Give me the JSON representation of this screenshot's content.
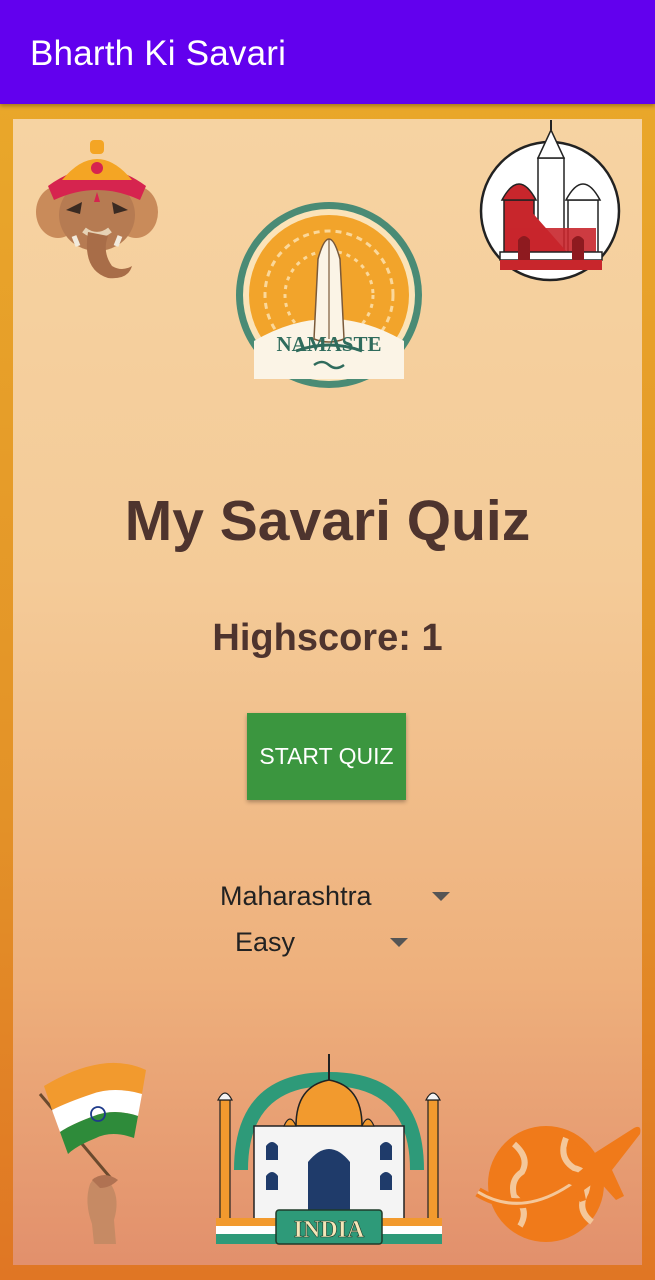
{
  "app": {
    "title": "Bharth Ki Savari"
  },
  "main": {
    "title": "My Savari Quiz",
    "highscore_label": "Highscore",
    "highscore_value": "1",
    "start_button": "START QUIZ",
    "state_spinner": "Maharashtra",
    "difficulty_spinner": "Easy"
  },
  "images": {
    "namaste_text": "NAMASTE",
    "india_text": "INDIA",
    "top_left": "ganesha-icon",
    "top_right": "cathedral-icon",
    "center": "namaste-emblem",
    "bottom_left": "india-flag-icon",
    "bottom_center": "taj-mahal-icon",
    "bottom_right": "globe-airplane-icon"
  },
  "colors": {
    "appbar": "#6200ee",
    "button": "#3b963f",
    "title_text": "#4e342e",
    "frame": "#e9a72a"
  }
}
